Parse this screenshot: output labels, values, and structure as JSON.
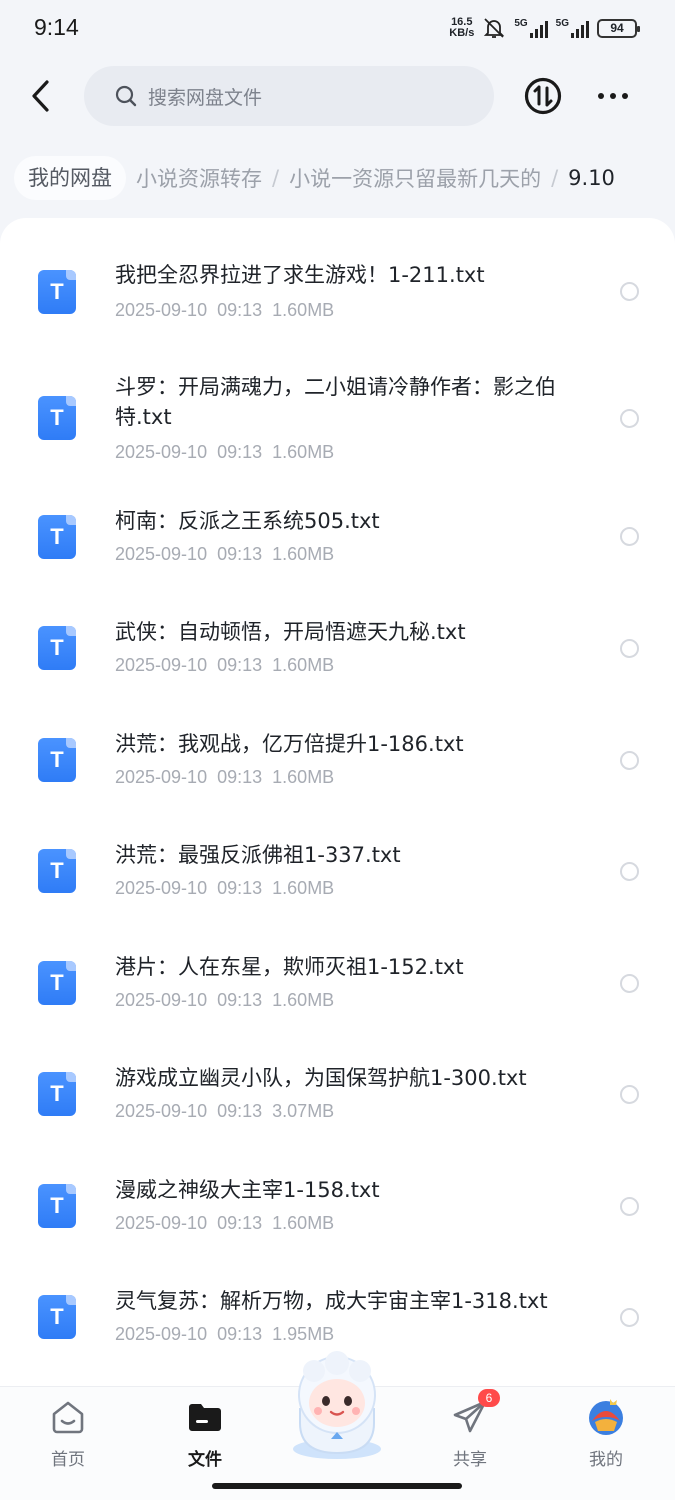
{
  "status": {
    "time": "9:14",
    "net_speed_value": "16.5",
    "net_speed_unit": "KB/s",
    "signal1_label": "5G",
    "signal2_label": "5G",
    "battery": "94"
  },
  "header": {
    "search_placeholder": "搜索网盘文件"
  },
  "breadcrumb": {
    "home": "我的网盘",
    "items": [
      "小说资源转存",
      "小说一资源只留最新几天的"
    ],
    "current": "9.10",
    "separator": "/"
  },
  "files": [
    {
      "name": "我把全忍界拉进了求生游戏！1-211.txt",
      "date": "2025-09-10",
      "time": "09:13",
      "size": "1.60MB"
    },
    {
      "name": "斗罗：开局满魂力，二小姐请冷静作者：影之伯特.txt",
      "date": "2025-09-10",
      "time": "09:13",
      "size": "1.60MB"
    },
    {
      "name": "柯南：反派之王系统505.txt",
      "date": "2025-09-10",
      "time": "09:13",
      "size": "1.60MB"
    },
    {
      "name": "武侠：自动顿悟，开局悟遮天九秘.txt",
      "date": "2025-09-10",
      "time": "09:13",
      "size": "1.60MB"
    },
    {
      "name": "洪荒：我观战，亿万倍提升1-186.txt",
      "date": "2025-09-10",
      "time": "09:13",
      "size": "1.60MB"
    },
    {
      "name": "洪荒：最强反派佛祖1-337.txt",
      "date": "2025-09-10",
      "time": "09:13",
      "size": "1.60MB"
    },
    {
      "name": "港片：人在东星，欺师灭祖1-152.txt",
      "date": "2025-09-10",
      "time": "09:13",
      "size": "1.60MB"
    },
    {
      "name": "游戏成立幽灵小队，为国保驾护航1-300.txt",
      "date": "2025-09-10",
      "time": "09:13",
      "size": "3.07MB"
    },
    {
      "name": "漫威之神级大主宰1-158.txt",
      "date": "2025-09-10",
      "time": "09:13",
      "size": "1.60MB"
    },
    {
      "name": "灵气复苏：解析万物，成大宇宙主宰1-318.txt",
      "date": "2025-09-10",
      "time": "09:13",
      "size": "1.95MB"
    }
  ],
  "file_icon_letter": "T",
  "nav": {
    "home": "首页",
    "files": "文件",
    "share": "共享",
    "share_badge": "6",
    "me": "我的"
  },
  "colors": {
    "accent": "#2f7cf6",
    "badge": "#ff4a4a"
  }
}
